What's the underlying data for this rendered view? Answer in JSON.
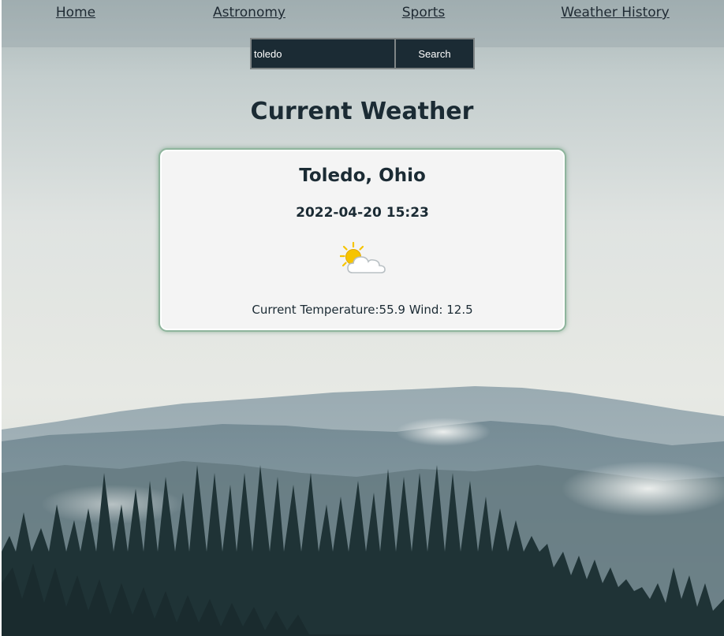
{
  "nav": {
    "home": "Home",
    "astronomy": "Astronomy",
    "sports": "Sports",
    "weather_history": "Weather History"
  },
  "search": {
    "value": "toledo",
    "button_label": "Search"
  },
  "page_title": "Current Weather",
  "weather": {
    "location": "Toledo, Ohio",
    "datetime": "2022-04-20 15:23",
    "icon": "partly-cloudy-icon",
    "temperature_label": "Current Temperature:",
    "temperature_value": "55.9",
    "wind_label": " Wind: ",
    "wind_value": "12.5"
  },
  "colors": {
    "dark_accent": "#1b2b34",
    "card_background": "#f4f4f4",
    "card_border": "#8fb59d",
    "sun": "#f6c400"
  }
}
